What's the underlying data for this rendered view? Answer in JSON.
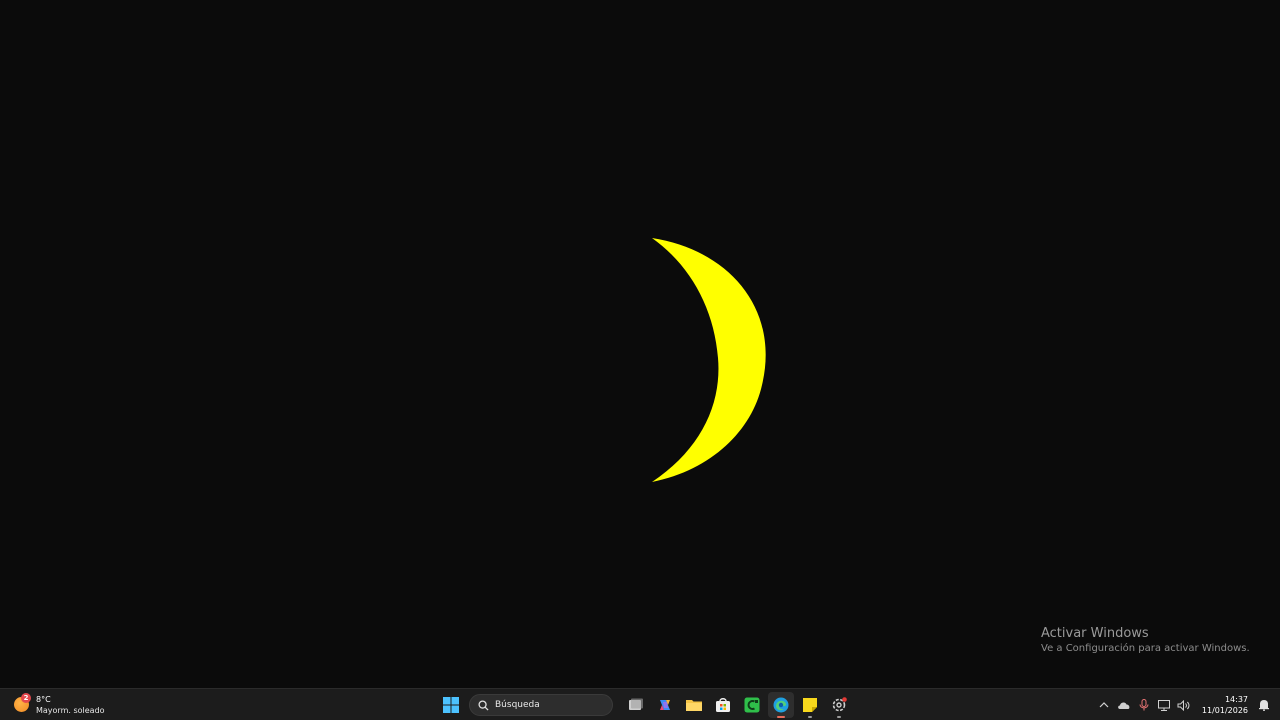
{
  "desktop": {
    "moon_color": "#ffff00",
    "background_color": "#0b0b0b"
  },
  "watermark": {
    "title": "Activar Windows",
    "subtitle": "Ve a Configuración para activar Windows."
  },
  "taskbar": {
    "weather": {
      "badge": "2",
      "temp": "8°C",
      "desc": "Mayorm. soleado",
      "icon": "sun-icon"
    },
    "search": {
      "label": "Búsqueda",
      "icon": "search-icon"
    },
    "apps": [
      {
        "name": "start-button",
        "icon": "windows-logo-icon"
      },
      {
        "name": "task-view-button",
        "icon": "task-view-icon"
      },
      {
        "name": "copilot-button",
        "icon": "copilot-icon"
      },
      {
        "name": "file-explorer-button",
        "icon": "folder-icon"
      },
      {
        "name": "store-button",
        "icon": "store-icon"
      },
      {
        "name": "app-green-button",
        "icon": "green-app-icon"
      },
      {
        "name": "edge-button",
        "icon": "edge-icon"
      },
      {
        "name": "sticky-notes-button",
        "icon": "sticky-notes-icon"
      },
      {
        "name": "settings-button",
        "icon": "settings-icon"
      }
    ],
    "tray": {
      "time": "14:37",
      "date": "11/01/2026"
    }
  }
}
